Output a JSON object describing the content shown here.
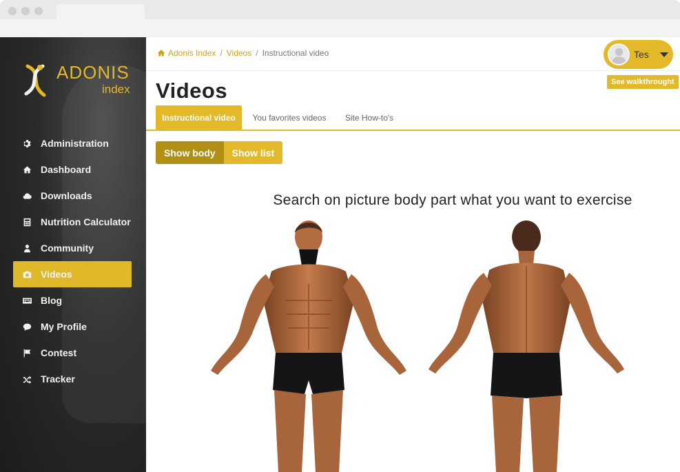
{
  "app": {
    "logo_title": "ADONIS",
    "logo_subtitle": "index"
  },
  "sidebar": {
    "items": [
      {
        "label": "Administration",
        "icon": "gear-icon"
      },
      {
        "label": "Dashboard",
        "icon": "home-icon"
      },
      {
        "label": "Downloads",
        "icon": "cloud-icon"
      },
      {
        "label": "Nutrition Calculator",
        "icon": "calculator-icon"
      },
      {
        "label": "Community",
        "icon": "user-icon"
      },
      {
        "label": "Videos",
        "icon": "camera-icon",
        "active": true
      },
      {
        "label": "Blog",
        "icon": "keyboard-icon"
      },
      {
        "label": "My Profile",
        "icon": "chat-icon"
      },
      {
        "label": "Contest",
        "icon": "flag-icon"
      },
      {
        "label": "Tracker",
        "icon": "shuffle-icon"
      }
    ]
  },
  "breadcrumb": {
    "home": "Adonis Index",
    "section": "Videos",
    "current": "Instructional video"
  },
  "user": {
    "name": "Tes"
  },
  "walkthrough_label": "See walkthrought",
  "page_title": "Videos",
  "tabs": [
    {
      "label": "Instructional video",
      "active": true
    },
    {
      "label": "You favorites videos"
    },
    {
      "label": "Site How-to's"
    }
  ],
  "view_toggle": {
    "show_body": "Show body",
    "show_list": "Show list",
    "selected": "Show body"
  },
  "headline": "Search on picture body part what you want to exercise",
  "colors": {
    "accent": "#e3b829",
    "accent_dark": "#b08f14",
    "sidebar_bg": "#2b2b2b"
  }
}
